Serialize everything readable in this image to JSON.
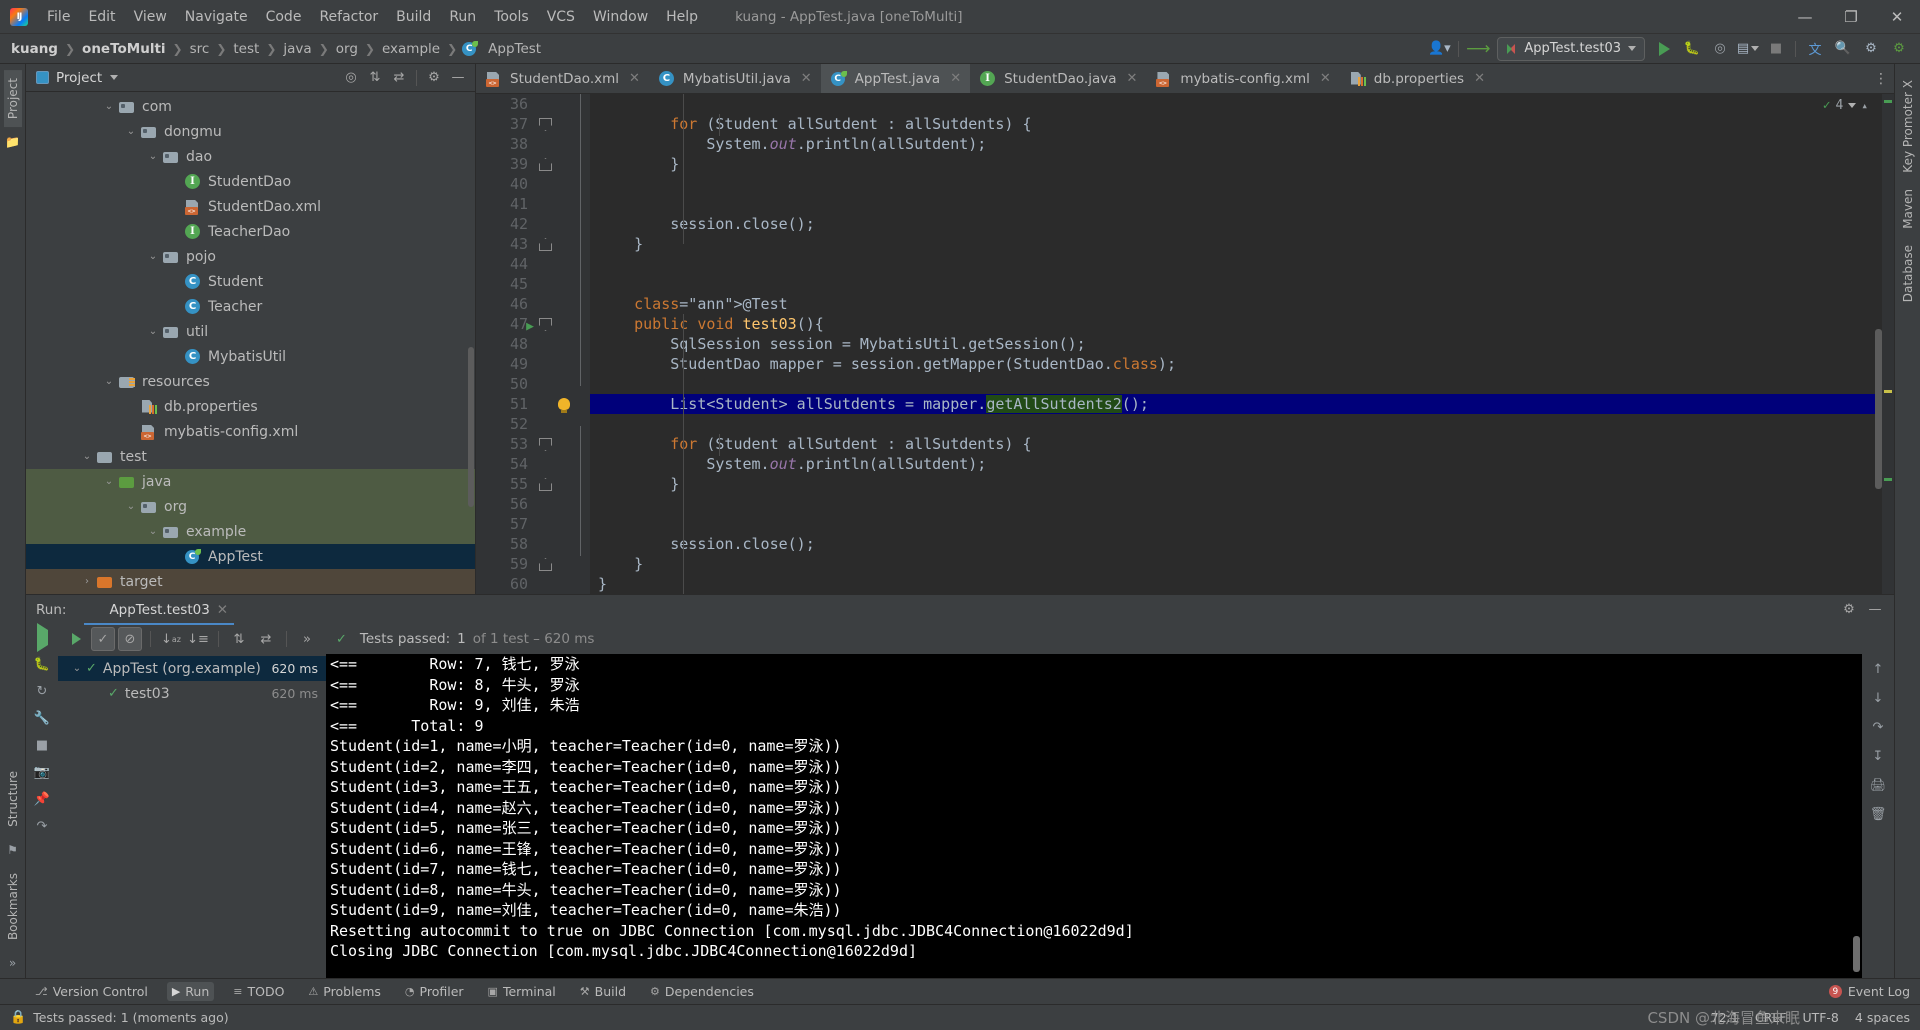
{
  "window": {
    "title": "kuang - AppTest.java [oneToMulti]",
    "minimize": "—",
    "maximize": "❐",
    "close": "✕"
  },
  "menu": {
    "items": [
      "File",
      "Edit",
      "View",
      "Navigate",
      "Code",
      "Refactor",
      "Build",
      "Run",
      "Tools",
      "VCS",
      "Window",
      "Help"
    ]
  },
  "breadcrumb": {
    "items": [
      "kuang",
      "oneToMulti",
      "src",
      "test",
      "java",
      "org",
      "example",
      "AppTest"
    ],
    "separator": "❯"
  },
  "nav_toolbar": {
    "run_config": "AppTest.test03",
    "icons": [
      "user-profile-icon",
      "updates-icon",
      "run-icon",
      "debug-icon",
      "run-coverage-icon",
      "profiler-icon",
      "stop-icon",
      "translate-icon",
      "search-icon",
      "settings-icon",
      "ide-help-icon"
    ]
  },
  "project_pane": {
    "title": "Project",
    "vertical_tabs": [
      "Project"
    ],
    "header_icons": [
      "locate-icon",
      "expand-all-icon",
      "collapse-all-icon",
      "settings-icon",
      "hide-icon"
    ],
    "tree": [
      {
        "label": "com",
        "indent": 3,
        "icon": "folder-pkg",
        "arrow": "⌄",
        "state": "none"
      },
      {
        "label": "dongmu",
        "indent": 4,
        "icon": "folder-pkg",
        "arrow": "⌄",
        "state": "none"
      },
      {
        "label": "dao",
        "indent": 5,
        "icon": "folder-pkg",
        "arrow": "⌄",
        "state": "none"
      },
      {
        "label": "StudentDao",
        "indent": 6,
        "icon": "interface",
        "arrow": "",
        "state": "none"
      },
      {
        "label": "StudentDao.xml",
        "indent": 6,
        "icon": "xml-file",
        "arrow": "",
        "state": "none"
      },
      {
        "label": "TeacherDao",
        "indent": 6,
        "icon": "interface",
        "arrow": "",
        "state": "none"
      },
      {
        "label": "pojo",
        "indent": 5,
        "icon": "folder-pkg",
        "arrow": "⌄",
        "state": "none"
      },
      {
        "label": "Student",
        "indent": 6,
        "icon": "class",
        "arrow": "",
        "state": "none"
      },
      {
        "label": "Teacher",
        "indent": 6,
        "icon": "class",
        "arrow": "",
        "state": "none"
      },
      {
        "label": "util",
        "indent": 5,
        "icon": "folder-pkg",
        "arrow": "⌄",
        "state": "none"
      },
      {
        "label": "MybatisUtil",
        "indent": 6,
        "icon": "class",
        "arrow": "",
        "state": "none"
      },
      {
        "label": "resources",
        "indent": 3,
        "icon": "folder-res",
        "arrow": "⌄",
        "state": "none"
      },
      {
        "label": "db.properties",
        "indent": 4,
        "icon": "properties",
        "arrow": "",
        "state": "none"
      },
      {
        "label": "mybatis-config.xml",
        "indent": 4,
        "icon": "xml-file",
        "arrow": "",
        "state": "none"
      },
      {
        "label": "test",
        "indent": 2,
        "icon": "folder-plain",
        "arrow": "⌄",
        "state": "none"
      },
      {
        "label": "java",
        "indent": 3,
        "icon": "folder-green",
        "arrow": "⌄",
        "state": "green"
      },
      {
        "label": "org",
        "indent": 4,
        "icon": "folder-pkg",
        "arrow": "⌄",
        "state": "green"
      },
      {
        "label": "example",
        "indent": 5,
        "icon": "folder-pkg",
        "arrow": "⌄",
        "state": "green"
      },
      {
        "label": "AppTest",
        "indent": 6,
        "icon": "test-class",
        "arrow": "",
        "state": "blue"
      },
      {
        "label": "target",
        "indent": 2,
        "icon": "folder-orange",
        "arrow": "›",
        "state": "brown"
      }
    ]
  },
  "editor": {
    "tabs": [
      {
        "label": "StudentDao.xml",
        "icon": "xml-file",
        "active": false,
        "close": "✕"
      },
      {
        "label": "MybatisUtil.java",
        "icon": "class",
        "active": false,
        "close": "✕"
      },
      {
        "label": "AppTest.java",
        "icon": "test-class",
        "active": true,
        "close": "✕"
      },
      {
        "label": "StudentDao.java",
        "icon": "interface",
        "active": false,
        "close": "✕"
      },
      {
        "label": "mybatis-config.xml",
        "icon": "xml-file",
        "active": false,
        "close": "✕"
      },
      {
        "label": "db.properties",
        "icon": "properties",
        "active": false,
        "close": "✕"
      }
    ],
    "inspection": {
      "count": "4",
      "check": "✓"
    },
    "first_line": 36,
    "lines": [
      {
        "n": 36,
        "text": "",
        "fold": "",
        "mark": "",
        "hl": false
      },
      {
        "n": 37,
        "text": "        for (Student allSutdent : allSutdents) {",
        "fold": "down",
        "mark": "",
        "hl": false
      },
      {
        "n": 38,
        "text": "            System.out.println(allSutdent);",
        "fold": "",
        "mark": "",
        "hl": false
      },
      {
        "n": 39,
        "text": "        }",
        "fold": "up",
        "mark": "",
        "hl": false
      },
      {
        "n": 40,
        "text": "",
        "fold": "",
        "mark": "",
        "hl": false
      },
      {
        "n": 41,
        "text": "",
        "fold": "",
        "mark": "",
        "hl": false
      },
      {
        "n": 42,
        "text": "        session.close();",
        "fold": "",
        "mark": "",
        "hl": false
      },
      {
        "n": 43,
        "text": "    }",
        "fold": "up",
        "mark": "",
        "hl": false
      },
      {
        "n": 44,
        "text": "",
        "fold": "",
        "mark": "",
        "hl": false
      },
      {
        "n": 45,
        "text": "",
        "fold": "",
        "mark": "",
        "hl": false
      },
      {
        "n": 46,
        "text": "    @Test",
        "fold": "",
        "mark": "",
        "hl": false
      },
      {
        "n": 47,
        "text": "    public void test03(){",
        "fold": "down",
        "mark": "run",
        "hl": false
      },
      {
        "n": 48,
        "text": "        SqlSession session = MybatisUtil.getSession();",
        "fold": "",
        "mark": "",
        "hl": false
      },
      {
        "n": 49,
        "text": "        StudentDao mapper = session.getMapper(StudentDao.class);",
        "fold": "",
        "mark": "",
        "hl": false
      },
      {
        "n": 50,
        "text": "",
        "fold": "",
        "mark": "",
        "hl": false
      },
      {
        "n": 51,
        "text": "        List<Student> allSutdents = mapper.getAllSutdents2();",
        "fold": "",
        "mark": "bulb",
        "hl": true
      },
      {
        "n": 52,
        "text": "",
        "fold": "",
        "mark": "",
        "hl": false
      },
      {
        "n": 53,
        "text": "        for (Student allSutdent : allSutdents) {",
        "fold": "down",
        "mark": "",
        "hl": false
      },
      {
        "n": 54,
        "text": "            System.out.println(allSutdent);",
        "fold": "",
        "mark": "",
        "hl": false
      },
      {
        "n": 55,
        "text": "        }",
        "fold": "up",
        "mark": "",
        "hl": false
      },
      {
        "n": 56,
        "text": "",
        "fold": "",
        "mark": "",
        "hl": false
      },
      {
        "n": 57,
        "text": "",
        "fold": "",
        "mark": "",
        "hl": false
      },
      {
        "n": 58,
        "text": "        session.close();",
        "fold": "",
        "mark": "",
        "hl": false
      },
      {
        "n": 59,
        "text": "    }",
        "fold": "up",
        "mark": "",
        "hl": false
      },
      {
        "n": 60,
        "text": "}",
        "fold": "",
        "mark": "",
        "hl": false
      }
    ]
  },
  "run_panel": {
    "label": "Run:",
    "tab": "AppTest.test03",
    "tab_close": "✕",
    "header_icons": [
      "settings-icon",
      "hide-icon"
    ],
    "toolbar_icons": [
      "rerun-icon",
      "show-passed-icon",
      "show-ignored-icon",
      "sort-alphabetically-icon",
      "sort-by-duration-icon",
      "expand-all-icon",
      "collapse-all-icon",
      "more-icon"
    ],
    "status": {
      "prefix": "Tests passed:",
      "count": "1",
      "suffix": "of 1 test – 620 ms",
      "icon": "check-icon"
    },
    "tree": [
      {
        "label": "AppTest (org.example)",
        "time": "620 ms",
        "selected": true,
        "arrow": "⌄",
        "indent": 0
      },
      {
        "label": "test03",
        "time": "620 ms",
        "selected": false,
        "arrow": "",
        "indent": 1
      }
    ],
    "console": [
      "<==        Row: 7, 钱七, 罗泳",
      "<==        Row: 8, 牛头, 罗泳",
      "<==        Row: 9, 刘佳, 朱浩",
      "<==      Total: 9",
      "Student(id=1, name=小明, teacher=Teacher(id=0, name=罗泳))",
      "Student(id=2, name=李四, teacher=Teacher(id=0, name=罗泳))",
      "Student(id=3, name=王五, teacher=Teacher(id=0, name=罗泳))",
      "Student(id=4, name=赵六, teacher=Teacher(id=0, name=罗泳))",
      "Student(id=5, name=张三, teacher=Teacher(id=0, name=罗泳))",
      "Student(id=6, name=王锋, teacher=Teacher(id=0, name=罗泳))",
      "Student(id=7, name=钱七, teacher=Teacher(id=0, name=罗泳))",
      "Student(id=8, name=牛头, teacher=Teacher(id=0, name=罗泳))",
      "Student(id=9, name=刘佳, teacher=Teacher(id=0, name=朱浩))",
      "Resetting autocommit to true on JDBC Connection [com.mysql.jdbc.JDBC4Connection@16022d9d]",
      "Closing JDBC Connection [com.mysql.jdbc.JDBC4Connection@16022d9d]"
    ]
  },
  "toolwindow_bar": {
    "items": [
      {
        "label": "Version Control",
        "icon": "branch-icon",
        "active": false
      },
      {
        "label": "Run",
        "icon": "play-icon",
        "active": true
      },
      {
        "label": "TODO",
        "icon": "list-icon",
        "active": false
      },
      {
        "label": "Problems",
        "icon": "warning-icon",
        "active": false
      },
      {
        "label": "Profiler",
        "icon": "gauge-icon",
        "active": false
      },
      {
        "label": "Terminal",
        "icon": "terminal-icon",
        "active": false
      },
      {
        "label": "Build",
        "icon": "hammer-icon",
        "active": false
      },
      {
        "label": "Dependencies",
        "icon": "dependency-icon",
        "active": false
      }
    ],
    "event_log": {
      "label": "Event Log",
      "badge": "9"
    }
  },
  "right_strip": {
    "tabs": [
      "Key Promoter X",
      "Maven",
      "Database"
    ]
  },
  "left_strip": {
    "tabs": [
      "Project",
      "Structure",
      "Bookmarks"
    ]
  },
  "statusbar": {
    "message": "Tests passed: 1 (moments ago)",
    "caret": "72:1",
    "line_sep": "CRLF",
    "encoding": "UTF-8",
    "indent": "4 spaces",
    "lock_icon": "lock-icon"
  },
  "watermark": "CSDN @北海冒鱼末眠"
}
